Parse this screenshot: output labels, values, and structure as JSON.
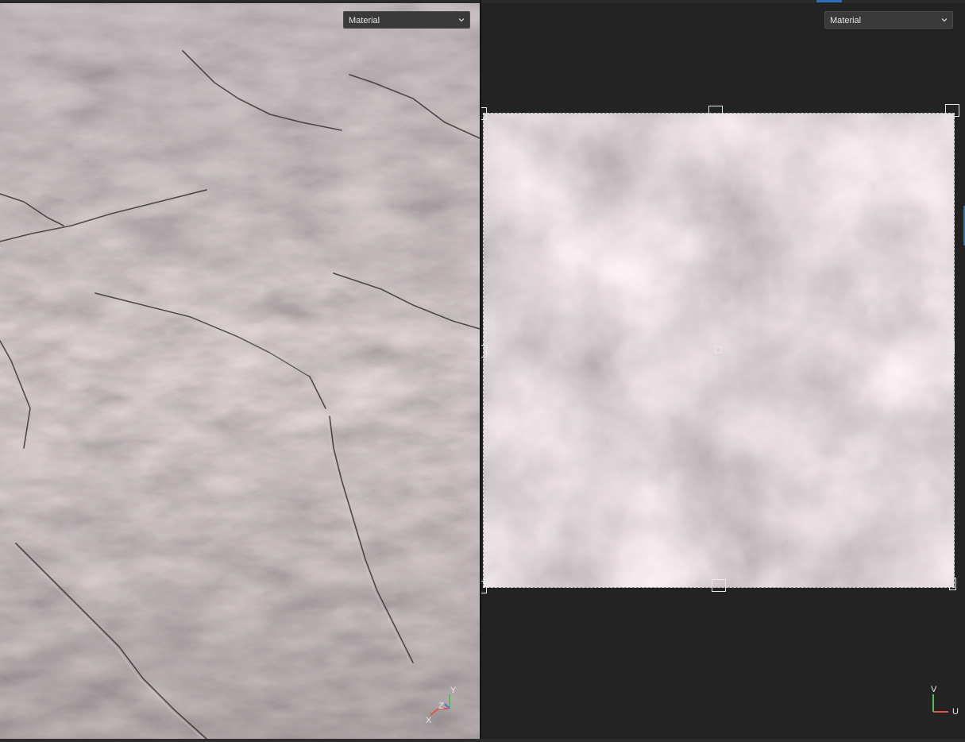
{
  "viewport_3d": {
    "shading_mode": "Material",
    "axis_gizmo": {
      "x_label": "X",
      "y_label": "Y",
      "z_label": "Z"
    }
  },
  "viewport_uv": {
    "shading_mode": "Material",
    "axis_gizmo": {
      "u_label": "U",
      "v_label": "V"
    }
  },
  "colors": {
    "accent": "#2d6fb8",
    "axis_x": "#d9534f",
    "axis_y": "#5cb85c",
    "axis_z": "#4a78c9",
    "handle": "#e8e8e8"
  }
}
